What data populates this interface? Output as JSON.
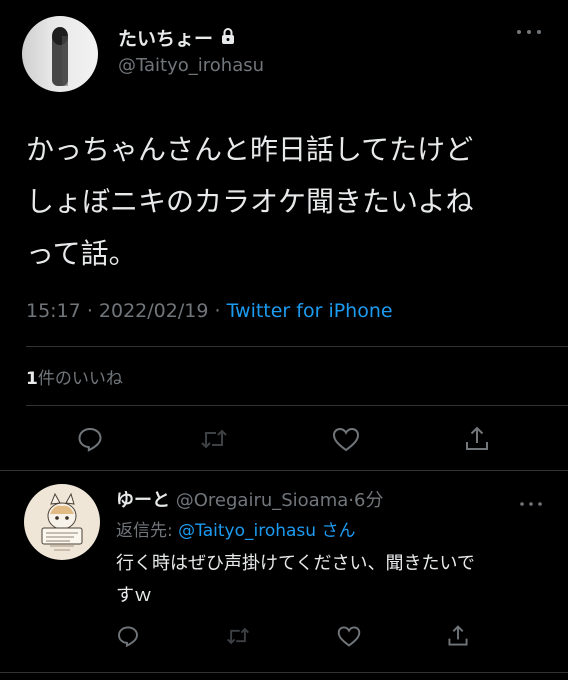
{
  "main_tweet": {
    "display_name": "たいちょー",
    "handle": "@Taityo_irohasu",
    "more_icon": "more-horizontal-icon",
    "lock_icon": "lock-icon",
    "text_line1": "かっちゃんさんと昨日話してたけど",
    "text_line2": "しょぼニキのカラオケ聞きたいよね",
    "text_line3": "って話。",
    "time": "15:17",
    "date": "2022/02/19",
    "sep1": "·",
    "sep2": "·",
    "source": "Twitter for iPhone",
    "likes_count": "1",
    "likes_label": "件のいいね"
  },
  "reply": {
    "display_name": "ゆーと",
    "handle": "@Oregairu_Sioama",
    "sep": "·",
    "time_ago": "6分",
    "replying_label": "返信先:",
    "replying_to": "@Taityo_irohasu",
    "replying_suffix": "さん",
    "text_line1": "行く時はぜひ声掛けてください、聞きたいで",
    "text_line2": "すｗ"
  },
  "colors": {
    "background": "#000000",
    "text": "#e7e9ea",
    "muted": "#71767b",
    "link": "#1d9bf0",
    "divider": "#2f3336"
  }
}
